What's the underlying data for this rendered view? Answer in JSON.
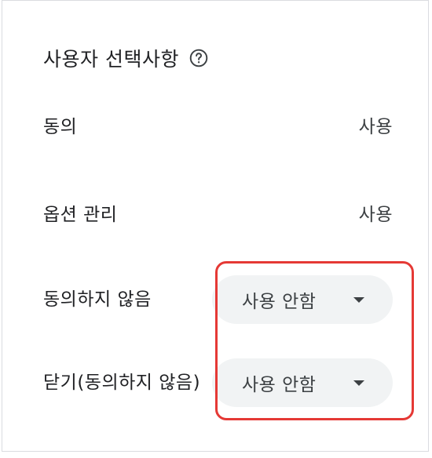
{
  "section": {
    "title": "사용자 선택사항",
    "help_icon": "help-circle-icon"
  },
  "rows": [
    {
      "label": "동의",
      "value": "사용"
    },
    {
      "label": "옵션 관리",
      "value": "사용"
    }
  ],
  "select_rows": [
    {
      "label": "동의하지 않음",
      "selected": "사용 안함"
    },
    {
      "label": "닫기(동의하지 않음)",
      "selected": "사용 안함"
    }
  ],
  "colors": {
    "highlight": "#e53935",
    "select_background": "#f1f3f4",
    "border": "#dadce0"
  }
}
